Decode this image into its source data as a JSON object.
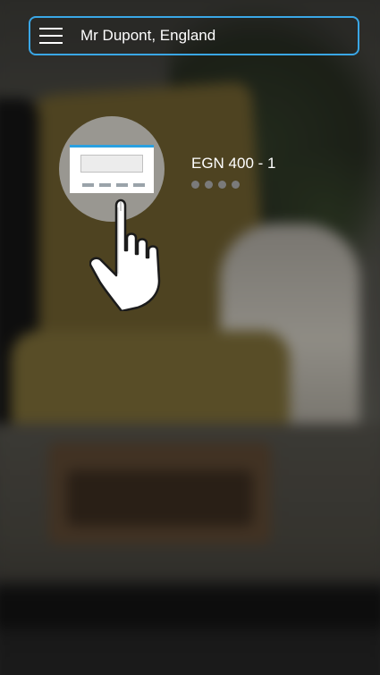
{
  "header": {
    "location": "Mr Dupont, England"
  },
  "device": {
    "name": "EGN 400 - 1",
    "status_dots": 4,
    "icon": "thermostat-icon"
  },
  "hint": {
    "icon": "tap-hand-icon"
  },
  "colors": {
    "accent": "#3aa7e6",
    "thermostat_stripe": "#2aa0e0"
  }
}
